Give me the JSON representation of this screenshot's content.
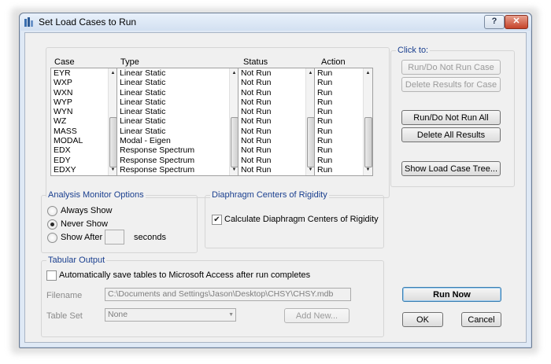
{
  "window": {
    "title": "Set Load Cases to Run",
    "help_label": "?",
    "close_label": "✕"
  },
  "columns": {
    "case": "Case",
    "type": "Type",
    "status": "Status",
    "action": "Action"
  },
  "cases": [
    {
      "case": "EYR",
      "type": "Linear Static",
      "status": "Not Run",
      "action": "Run"
    },
    {
      "case": "WXP",
      "type": "Linear Static",
      "status": "Not Run",
      "action": "Run"
    },
    {
      "case": "WXN",
      "type": "Linear Static",
      "status": "Not Run",
      "action": "Run"
    },
    {
      "case": "WYP",
      "type": "Linear Static",
      "status": "Not Run",
      "action": "Run"
    },
    {
      "case": "WYN",
      "type": "Linear Static",
      "status": "Not Run",
      "action": "Run"
    },
    {
      "case": "WZ",
      "type": "Linear Static",
      "status": "Not Run",
      "action": "Run"
    },
    {
      "case": "MASS",
      "type": "Linear Static",
      "status": "Not Run",
      "action": "Run"
    },
    {
      "case": "MODAL",
      "type": "Modal - Eigen",
      "status": "Not Run",
      "action": "Run"
    },
    {
      "case": "EDX",
      "type": "Response Spectrum",
      "status": "Not Run",
      "action": "Run"
    },
    {
      "case": "EDY",
      "type": "Response Spectrum",
      "status": "Not Run",
      "action": "Run"
    },
    {
      "case": "EDXY",
      "type": "Response Spectrum",
      "status": "Not Run",
      "action": "Run"
    }
  ],
  "click_to": {
    "label": "Click to:",
    "run_do_not_run_case": "Run/Do Not Run Case",
    "delete_results_for_case": "Delete Results for Case",
    "run_do_not_run_all": "Run/Do Not Run All",
    "delete_all_results": "Delete All Results",
    "show_load_case_tree": "Show Load Case Tree..."
  },
  "analysis_monitor": {
    "label": "Analysis Monitor Options",
    "always_show": "Always Show",
    "never_show": "Never Show",
    "show_after": "Show After",
    "seconds_value": "",
    "seconds_label": "seconds",
    "selected": "never_show"
  },
  "diaphragm": {
    "label": "Diaphragm Centers of Rigidity",
    "calculate_label": "Calculate Diaphragm Centers of Rigidity",
    "checked": true
  },
  "tabular_output": {
    "label": "Tabular Output",
    "auto_save_label": "Automatically save tables to Microsoft Access after run completes",
    "auto_save_checked": false,
    "filename_label": "Filename",
    "filename_value": "C:\\Documents and Settings\\Jason\\Desktop\\CHSY\\CHSY.mdb",
    "table_set_label": "Table Set",
    "table_set_value": "None",
    "add_new_label": "Add New..."
  },
  "buttons": {
    "run_now": "Run Now",
    "ok": "OK",
    "cancel": "Cancel"
  },
  "colors": {
    "title_accent": "#1a3f8f",
    "close_button": "#c5432a",
    "window_frame": "#dfe9f5"
  },
  "icons": [
    "app-icon",
    "help-icon",
    "close-icon",
    "scroll-up-icon",
    "scroll-down-icon",
    "radio-icon",
    "checkbox-icon",
    "dropdown-arrow-icon"
  ]
}
